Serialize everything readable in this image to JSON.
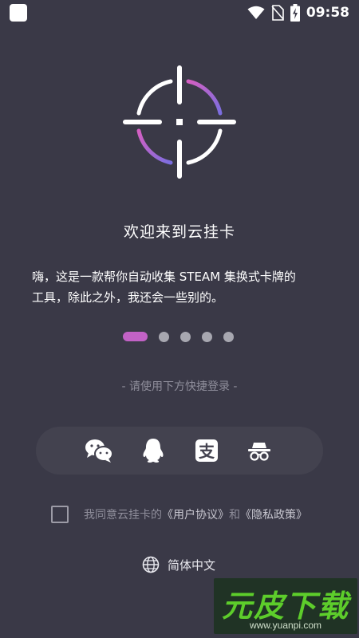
{
  "status_bar": {
    "time": "09:58",
    "icons": [
      "app-icon",
      "wifi-icon",
      "no-sim-icon",
      "battery-charging-icon"
    ]
  },
  "logo": {
    "icon": "crosshair-logo-icon",
    "colors": {
      "primary": "#ffffff",
      "accent": "#c262c6",
      "accent_end": "#7b6ee0"
    }
  },
  "welcome": {
    "title": "欢迎来到云挂卡",
    "description_line1": "嗨，这是一款帮你自动收集 STEAM 集换式卡牌的",
    "description_line2": "工具，除此之外，我还会一些别的。"
  },
  "pager": {
    "total": 5,
    "current": 1
  },
  "login": {
    "prompt": "- 请使用下方快捷登录 -",
    "methods": [
      {
        "name": "wechat",
        "icon": "wechat-icon"
      },
      {
        "name": "qq",
        "icon": "qq-icon"
      },
      {
        "name": "alipay",
        "icon": "alipay-icon"
      },
      {
        "name": "incognito",
        "icon": "incognito-icon"
      }
    ]
  },
  "agreement": {
    "checked": false,
    "prefix": "我同意云挂卡的",
    "user_agreement": "《用户协议》",
    "and": "和",
    "privacy_policy": "《隐私政策》"
  },
  "language": {
    "icon": "globe-icon",
    "label": "简体中文"
  },
  "watermark": {
    "title": "元皮下载",
    "url": "www.yuanpi.com"
  },
  "colors": {
    "background": "#3a3947",
    "panel": "#43424f",
    "accent": "#c262c6",
    "muted": "#8f8e9b"
  }
}
